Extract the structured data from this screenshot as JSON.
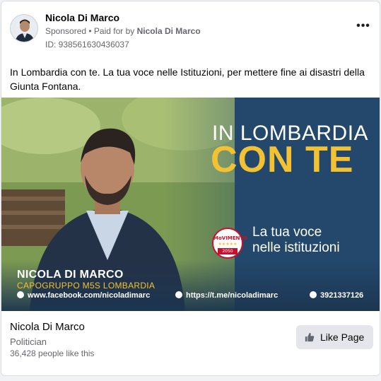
{
  "post": {
    "author": "Nicola Di Marco",
    "sponsored_label": "Sponsored",
    "paid_for_prefix": " • Paid for by ",
    "paid_for_name": "Nicola Di Marco",
    "ad_id": "ID: 938561630436037",
    "more_icon": "more-options-icon",
    "body_text": "In Lombardia con te. La tua voce nelle Istituzioni, per mettere fine ai disastri della Giunta Fontana."
  },
  "ad_image": {
    "headline_line1": "IN LOMBARDIA",
    "headline_line2": "CON TE",
    "tagline_line1": "La tua voce",
    "tagline_line2": "nelle istituzioni",
    "overlay_name": "NICOLA DI MARCO",
    "overlay_role": "CAPOGRUPPO M5S LOMBARDIA",
    "contact_facebook": "www.facebook.com/nicoladimarc",
    "contact_telegram": "https://t.me/nicoladimarc",
    "contact_phone": "3921337126",
    "logo_text": "MoVIMENTO",
    "logo_stars": "★★★★★",
    "logo_year": "2050",
    "colors": {
      "background": "#23486c",
      "accent": "#f2c233",
      "logo_red": "#c8102e"
    }
  },
  "footer": {
    "page_name": "Nicola Di Marco",
    "category": "Politician",
    "likes": "36,428 people like this",
    "like_button_label": "Like Page"
  }
}
